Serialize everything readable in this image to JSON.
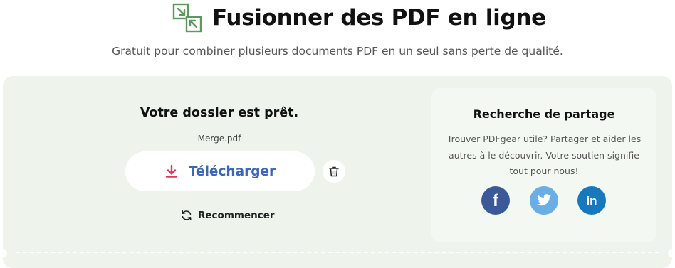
{
  "header": {
    "title": "Fusionner des PDF en ligne",
    "subtitle": "Gratuit pour combiner plusieurs documents PDF en un seul sans perte de qualité.",
    "logo_icon": "merge-arrows-icon"
  },
  "result": {
    "heading": "Votre dossier est prêt.",
    "filename": "Merge.pdf",
    "download_label": "Télécharger",
    "download_icon": "download-arrow-icon",
    "delete_icon": "trash-icon",
    "restart_label": "Recommencer",
    "restart_icon": "refresh-icon"
  },
  "share": {
    "title": "Recherche de partage",
    "text": "Trouver PDFgear utile? Partager et aider les autres à le découvrir. Votre soutien signifie tout pour nous!",
    "facebook_icon": "facebook-icon",
    "twitter_icon": "twitter-icon",
    "linkedin_icon": "linkedin-icon",
    "facebook_glyph": "f",
    "linkedin_glyph": "in"
  },
  "colors": {
    "panel_bg": "#eef4ec",
    "accent_blue": "#3c67b8",
    "download_red": "#e8354f",
    "logo_green": "#5a9a5e",
    "facebook": "#3b5998",
    "twitter": "#6aaee5",
    "linkedin": "#1778bd"
  }
}
